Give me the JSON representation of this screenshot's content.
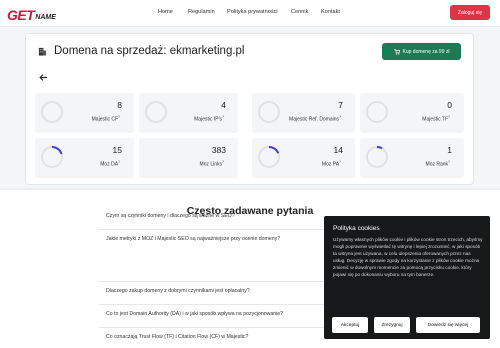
{
  "nav": {
    "logo_main": "GET",
    "logo_sub": "NAME",
    "links": [
      "Home",
      "Regulamin",
      "Polityka prywatności",
      "Cennik",
      "Kontakt"
    ],
    "login_label": "Zaloguj się"
  },
  "card": {
    "title": "Domena na sprzedaż: ekmarketing.pl",
    "buy_label": "Kup domenę za 99 zł",
    "back_icon": "arrow-left-icon",
    "building_icon": "building-icon"
  },
  "metrics": [
    {
      "value": "8",
      "label": "Majestic CF"
    },
    {
      "value": "4",
      "label": "Majestic IP's"
    },
    {
      "value": "7",
      "label": "Majestic Ref. Domains"
    },
    {
      "value": "0",
      "label": "Majestic TF"
    },
    {
      "value": "15",
      "label": "Moz DA"
    },
    {
      "value": "383",
      "label": "Moz Links"
    },
    {
      "value": "14",
      "label": "Moz PA"
    },
    {
      "value": "1",
      "label": "Moz Rank"
    }
  ],
  "faq": {
    "title": "Często zadawane pytania",
    "items": [
      "Czym są czynniki domeny i dlaczego są ważne w SEO?",
      "Jakie metryki z MOZ i Majestic SEO są najważniejsze przy ocenie domeny?",
      "Dlaczego zakup domeny z dobrymi czynnikami jest opłacalny?",
      "Co to jest Domain Authority (DA) i w jaki sposób wpływa na pozycjonowanie?",
      "Co oznaczają Trust Flow (TF) i Citation Flow (CF) w Majestic?"
    ]
  },
  "cookie": {
    "title": "Polityka cookies",
    "text": "Używamy własnych plików cookie i plików cookie stron trzecich, abyśmy mogli poprawnie wyświetlać tę witrynę i lepiej zrozumieć, w jaki sposób ta witryna jest używana, w celu ulepszenia oferowanych przez nas usług. Decyzję w sprawie zgody na korzystanie z plików cookie można zmienić w dowolnym momencie za pomocą przycisku cookie, który pojawi się po dokonaniu wyboru na tym banerze.",
    "accept_label": "Akceptuj",
    "reject_label": "Zrezygnuj",
    "more_label": "Dowiedz się więcej"
  },
  "colors": {
    "brand_red": "#dc3545",
    "buy_green": "#1d7a54",
    "ring_accent": "#3d3dd8",
    "cookie_bg": "#17181a"
  }
}
